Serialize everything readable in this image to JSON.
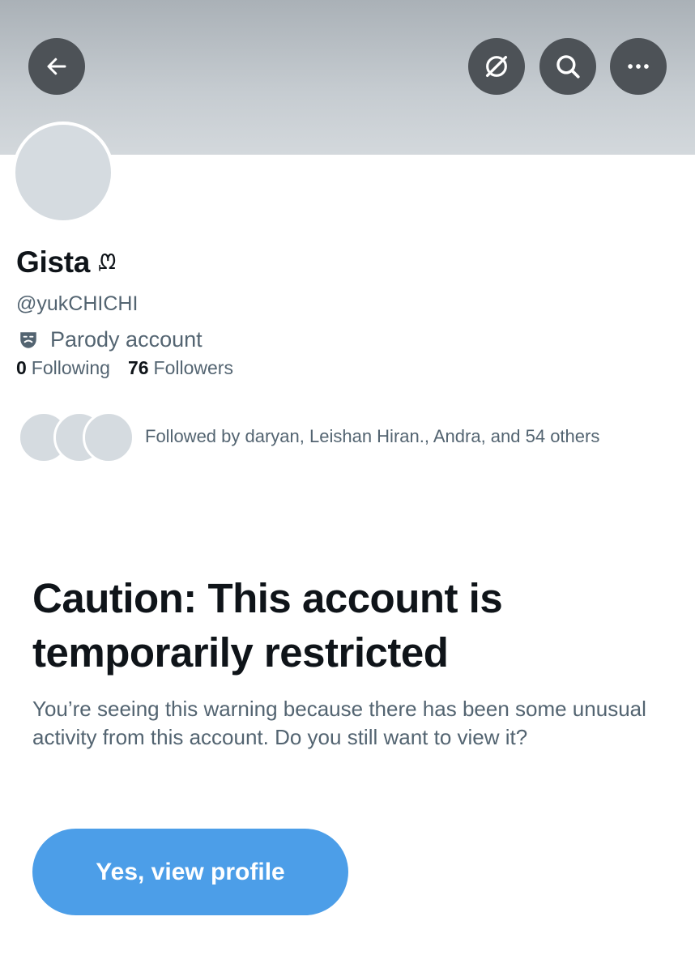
{
  "header": {
    "back_icon": "arrow-left-icon",
    "actions": [
      {
        "icon": "grok-icon"
      },
      {
        "icon": "search-icon"
      },
      {
        "icon": "more-icon"
      }
    ],
    "banner_color": "#c6ccd1",
    "button_color": "#4d5257"
  },
  "profile": {
    "display_name": "Gista",
    "name_badge": "ᘻ",
    "handle": "@yukCHICHI",
    "parody_label": "Parody account",
    "following_count": "0",
    "following_label": "Following",
    "followers_count": "76",
    "followers_label": "Followers",
    "followed_by": "Followed by daryan, Leishan Hiran., Andra, and 54 others"
  },
  "warning": {
    "title": "Caution: This account is temporarily restricted",
    "body": "You’re seeing this warning because there has been some unusual activity from this account. Do you still want to view it?",
    "button_label": "Yes, view profile",
    "button_color": "#4c9ee8"
  }
}
